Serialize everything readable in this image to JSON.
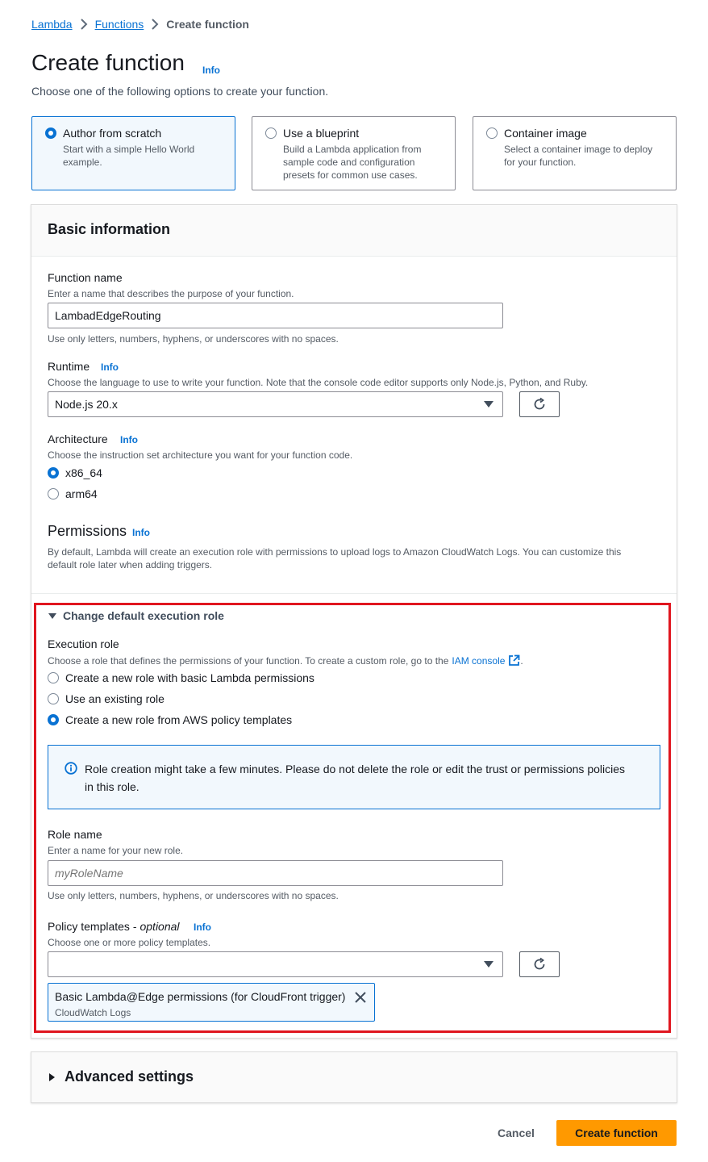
{
  "breadcrumb": {
    "root": "Lambda",
    "functions": "Functions",
    "current": "Create function"
  },
  "page": {
    "title": "Create function",
    "info": "Info",
    "description": "Choose one of the following options to create your function."
  },
  "options": [
    {
      "label": "Author from scratch",
      "description": "Start with a simple Hello World example.",
      "selected": true
    },
    {
      "label": "Use a blueprint",
      "description": "Build a Lambda application from sample code and configuration presets for common use cases.",
      "selected": false
    },
    {
      "label": "Container image",
      "description": "Select a container image to deploy for your function.",
      "selected": false
    }
  ],
  "basic": {
    "title": "Basic information",
    "function_name": {
      "label": "Function name",
      "description": "Enter a name that describes the purpose of your function.",
      "value": "LambadEdgeRouting",
      "hint": "Use only letters, numbers, hyphens, or underscores with no spaces."
    },
    "runtime": {
      "label": "Runtime",
      "info": "Info",
      "description": "Choose the language to use to write your function. Note that the console code editor supports only Node.js, Python, and Ruby.",
      "value": "Node.js 20.x"
    },
    "architecture": {
      "label": "Architecture",
      "info": "Info",
      "description": "Choose the instruction set architecture you want for your function code.",
      "options": [
        "x86_64",
        "arm64"
      ],
      "selected": "x86_64"
    },
    "permissions": {
      "title": "Permissions",
      "info": "Info",
      "description": "By default, Lambda will create an execution role with permissions to upload logs to Amazon CloudWatch Logs. You can customize this default role later when adding triggers."
    }
  },
  "execution": {
    "expander": "Change default execution role",
    "label": "Execution role",
    "description": "Choose a role that defines the permissions of your function. To create a custom role, go to the",
    "iam_link": "IAM console",
    "period": ".",
    "options": [
      "Create a new role with basic Lambda permissions",
      "Use an existing role",
      "Create a new role from AWS policy templates"
    ],
    "selected_index": 2,
    "alert": "Role creation might take a few minutes. Please do not delete the role or edit the trust or permissions policies in this role.",
    "role_name": {
      "label": "Role name",
      "description": "Enter a name for your new role.",
      "placeholder": "myRoleName",
      "hint": "Use only letters, numbers, hyphens, or underscores with no spaces."
    },
    "policy": {
      "label": "Policy templates - ",
      "optional": "optional",
      "info": "Info",
      "description": "Choose one or more policy templates.",
      "token_title": "Basic Lambda@Edge permissions (for CloudFront trigger)",
      "token_sub": "CloudWatch Logs"
    }
  },
  "advanced": {
    "label": "Advanced settings"
  },
  "actions": {
    "cancel": "Cancel",
    "create": "Create function"
  },
  "colors": {
    "accent": "#0972d3",
    "primary": "#ff9900",
    "highlight": "#e0161f"
  }
}
